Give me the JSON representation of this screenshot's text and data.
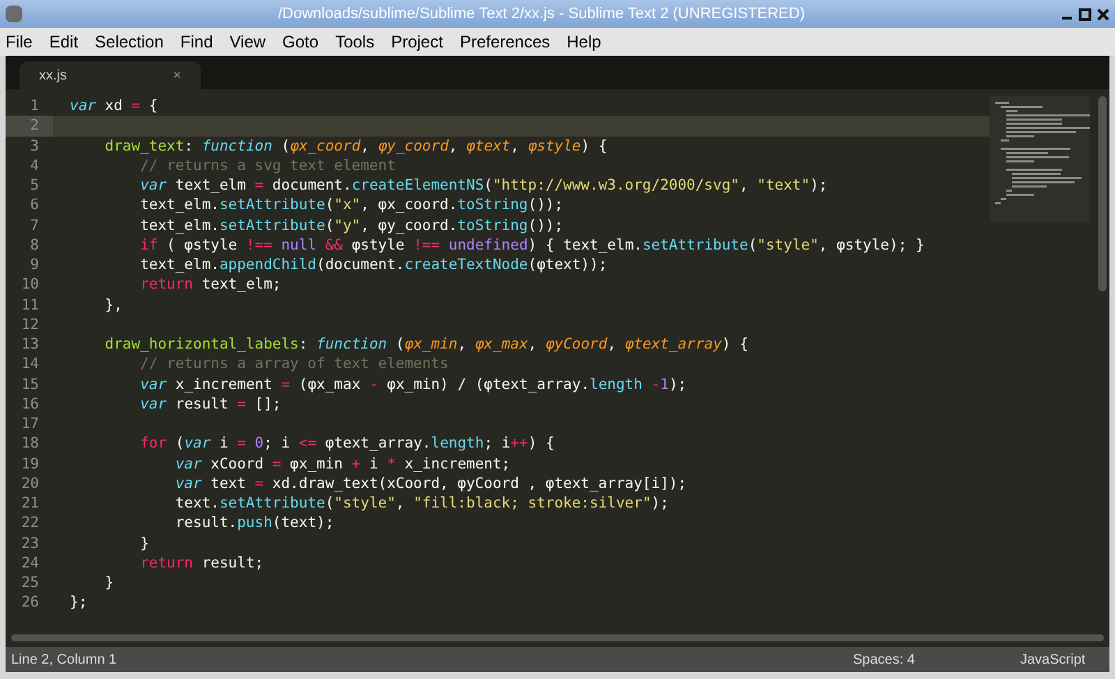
{
  "window": {
    "title": "/Downloads/sublime/Sublime Text 2/xx.js - Sublime Text 2 (UNREGISTERED)"
  },
  "menu": [
    "File",
    "Edit",
    "Selection",
    "Find",
    "View",
    "Goto",
    "Tools",
    "Project",
    "Preferences",
    "Help"
  ],
  "tabs": [
    {
      "label": "xx.js",
      "close": "×",
      "selected": true
    }
  ],
  "editor": {
    "lines": [
      {
        "number": "1",
        "selected": false,
        "tokens": [
          {
            "kind": "kw",
            "text": "var"
          },
          {
            "kind": "plain",
            "text": " xd "
          },
          {
            "kind": "op",
            "text": "="
          },
          {
            "kind": "plain",
            "text": " {"
          }
        ]
      },
      {
        "number": "2",
        "selected": true
      },
      {
        "number": "3",
        "selected": false,
        "tokens": [
          {
            "kind": "fn",
            "text": "    draw_text"
          },
          {
            "kind": "plain",
            "text": ": "
          },
          {
            "kind": "kw",
            "text": "function"
          },
          {
            "kind": "plain",
            "text": " ("
          },
          {
            "kind": "param",
            "text": "φx_coord"
          },
          {
            "kind": "plain",
            "text": ", "
          },
          {
            "kind": "param",
            "text": "φy_coord"
          },
          {
            "kind": "plain",
            "text": ", "
          },
          {
            "kind": "param",
            "text": "φtext"
          },
          {
            "kind": "plain",
            "text": ", "
          },
          {
            "kind": "param",
            "text": "φstyle"
          },
          {
            "kind": "plain",
            "text": ") {"
          }
        ]
      },
      {
        "number": "4",
        "selected": false,
        "tokens": [
          {
            "kind": "cmt",
            "text": "        // returns a svg text element"
          }
        ]
      },
      {
        "number": "5",
        "selected": false,
        "tokens": [
          {
            "kind": "kw",
            "text": "        var"
          },
          {
            "kind": "plain",
            "text": " text_elm "
          },
          {
            "kind": "op",
            "text": "="
          },
          {
            "kind": "plain",
            "text": " document."
          },
          {
            "kind": "sup",
            "text": "createElementNS"
          },
          {
            "kind": "plain",
            "text": "("
          },
          {
            "kind": "str",
            "text": "\"http://www.w3.org/2000/svg\""
          },
          {
            "kind": "plain",
            "text": ", "
          },
          {
            "kind": "str",
            "text": "\"text\""
          },
          {
            "kind": "plain",
            "text": ");"
          }
        ]
      },
      {
        "number": "6",
        "selected": false,
        "tokens": [
          {
            "kind": "plain",
            "text": "        text_elm."
          },
          {
            "kind": "sup",
            "text": "setAttribute"
          },
          {
            "kind": "plain",
            "text": "("
          },
          {
            "kind": "str",
            "text": "\"x\""
          },
          {
            "kind": "plain",
            "text": ", φx_coord."
          },
          {
            "kind": "sup",
            "text": "toString"
          },
          {
            "kind": "plain",
            "text": "());"
          }
        ]
      },
      {
        "number": "7",
        "selected": false,
        "tokens": [
          {
            "kind": "plain",
            "text": "        text_elm."
          },
          {
            "kind": "sup",
            "text": "setAttribute"
          },
          {
            "kind": "plain",
            "text": "("
          },
          {
            "kind": "str",
            "text": "\"y\""
          },
          {
            "kind": "plain",
            "text": ", φy_coord."
          },
          {
            "kind": "sup",
            "text": "toString"
          },
          {
            "kind": "plain",
            "text": "());"
          }
        ]
      },
      {
        "number": "8",
        "selected": false,
        "tokens": [
          {
            "kind": "ctl",
            "text": "        if"
          },
          {
            "kind": "plain",
            "text": " ( φstyle "
          },
          {
            "kind": "op",
            "text": "!== "
          },
          {
            "kind": "const",
            "text": "null "
          },
          {
            "kind": "op",
            "text": "&&"
          },
          {
            "kind": "plain",
            "text": " φstyle "
          },
          {
            "kind": "op",
            "text": "!== "
          },
          {
            "kind": "const",
            "text": "undefined"
          },
          {
            "kind": "plain",
            "text": ") { text_elm."
          },
          {
            "kind": "sup",
            "text": "setAttribute"
          },
          {
            "kind": "plain",
            "text": "("
          },
          {
            "kind": "str",
            "text": "\"style\""
          },
          {
            "kind": "plain",
            "text": ", φstyle); }"
          }
        ]
      },
      {
        "number": "9",
        "selected": false,
        "tokens": [
          {
            "kind": "plain",
            "text": "        text_elm."
          },
          {
            "kind": "sup",
            "text": "appendChild"
          },
          {
            "kind": "plain",
            "text": "(document."
          },
          {
            "kind": "sup",
            "text": "createTextNode"
          },
          {
            "kind": "plain",
            "text": "(φtext));"
          }
        ]
      },
      {
        "number": "10",
        "selected": false,
        "tokens": [
          {
            "kind": "ctl",
            "text": "        return"
          },
          {
            "kind": "plain",
            "text": " text_elm;"
          }
        ]
      },
      {
        "number": "11",
        "selected": false,
        "tokens": [
          {
            "kind": "plain",
            "text": "    },"
          }
        ]
      },
      {
        "number": "12",
        "selected": false
      },
      {
        "number": "13",
        "selected": false,
        "tokens": [
          {
            "kind": "fn",
            "text": "    draw_horizontal_labels"
          },
          {
            "kind": "plain",
            "text": ": "
          },
          {
            "kind": "kw",
            "text": "function"
          },
          {
            "kind": "plain",
            "text": " ("
          },
          {
            "kind": "param",
            "text": "φx_min"
          },
          {
            "kind": "plain",
            "text": ", "
          },
          {
            "kind": "param",
            "text": "φx_max"
          },
          {
            "kind": "plain",
            "text": ", "
          },
          {
            "kind": "param",
            "text": "φyCoord"
          },
          {
            "kind": "plain",
            "text": ", "
          },
          {
            "kind": "param",
            "text": "φtext_array"
          },
          {
            "kind": "plain",
            "text": ") {"
          }
        ]
      },
      {
        "number": "14",
        "selected": false,
        "tokens": [
          {
            "kind": "cmt",
            "text": "        // returns a array of text elements"
          }
        ]
      },
      {
        "number": "15",
        "selected": false,
        "tokens": [
          {
            "kind": "kw",
            "text": "        var"
          },
          {
            "kind": "plain",
            "text": " x_increment "
          },
          {
            "kind": "op",
            "text": "="
          },
          {
            "kind": "plain",
            "text": " (φx_max "
          },
          {
            "kind": "op",
            "text": "-"
          },
          {
            "kind": "plain",
            "text": " φx_min) / (φtext_array."
          },
          {
            "kind": "sup",
            "text": "length"
          },
          {
            "kind": "op",
            "text": " -"
          },
          {
            "kind": "num",
            "text": "1"
          },
          {
            "kind": "plain",
            "text": ");"
          }
        ]
      },
      {
        "number": "16",
        "selected": false,
        "tokens": [
          {
            "kind": "kw",
            "text": "        var"
          },
          {
            "kind": "plain",
            "text": " result "
          },
          {
            "kind": "op",
            "text": "="
          },
          {
            "kind": "plain",
            "text": " [];"
          }
        ]
      },
      {
        "number": "17",
        "selected": false
      },
      {
        "number": "18",
        "selected": false,
        "tokens": [
          {
            "kind": "ctl",
            "text": "        for"
          },
          {
            "kind": "plain",
            "text": " ("
          },
          {
            "kind": "kw",
            "text": "var"
          },
          {
            "kind": "plain",
            "text": " i "
          },
          {
            "kind": "op",
            "text": "= "
          },
          {
            "kind": "num",
            "text": "0"
          },
          {
            "kind": "plain",
            "text": "; i "
          },
          {
            "kind": "op",
            "text": "<="
          },
          {
            "kind": "plain",
            "text": " φtext_array."
          },
          {
            "kind": "sup",
            "text": "length"
          },
          {
            "kind": "plain",
            "text": "; i"
          },
          {
            "kind": "op",
            "text": "++"
          },
          {
            "kind": "plain",
            "text": ") {"
          }
        ]
      },
      {
        "number": "19",
        "selected": false,
        "tokens": [
          {
            "kind": "kw",
            "text": "            var"
          },
          {
            "kind": "plain",
            "text": " xCoord "
          },
          {
            "kind": "op",
            "text": "="
          },
          {
            "kind": "plain",
            "text": " φx_min "
          },
          {
            "kind": "op",
            "text": "+"
          },
          {
            "kind": "plain",
            "text": " i "
          },
          {
            "kind": "op",
            "text": "*"
          },
          {
            "kind": "plain",
            "text": " x_increment;"
          }
        ]
      },
      {
        "number": "20",
        "selected": false,
        "tokens": [
          {
            "kind": "kw",
            "text": "            var"
          },
          {
            "kind": "plain",
            "text": " text "
          },
          {
            "kind": "op",
            "text": "="
          },
          {
            "kind": "plain",
            "text": " xd.draw_text(xCoord, φyCoord , φtext_array[i]);"
          }
        ]
      },
      {
        "number": "21",
        "selected": false,
        "tokens": [
          {
            "kind": "plain",
            "text": "            text."
          },
          {
            "kind": "sup",
            "text": "setAttribute"
          },
          {
            "kind": "plain",
            "text": "("
          },
          {
            "kind": "str",
            "text": "\"style\""
          },
          {
            "kind": "plain",
            "text": ", "
          },
          {
            "kind": "str",
            "text": "\"fill:black; stroke:silver\""
          },
          {
            "kind": "plain",
            "text": ");"
          }
        ]
      },
      {
        "number": "22",
        "selected": false,
        "tokens": [
          {
            "kind": "plain",
            "text": "            result."
          },
          {
            "kind": "sup",
            "text": "push"
          },
          {
            "kind": "plain",
            "text": "(text);"
          }
        ]
      },
      {
        "number": "23",
        "selected": false,
        "tokens": [
          {
            "kind": "plain",
            "text": "        }"
          }
        ]
      },
      {
        "number": "24",
        "selected": false,
        "tokens": [
          {
            "kind": "ctl",
            "text": "        return"
          },
          {
            "kind": "plain",
            "text": " result;"
          }
        ]
      },
      {
        "number": "25",
        "selected": false,
        "tokens": [
          {
            "kind": "plain",
            "text": "    }"
          }
        ]
      },
      {
        "number": "26",
        "selected": false,
        "tokens": [
          {
            "kind": "plain",
            "text": "};"
          }
        ]
      }
    ]
  },
  "status_bar": {
    "position": "Line 2, Column 1",
    "indentation": "Spaces: 4",
    "syntax": "JavaScript"
  }
}
